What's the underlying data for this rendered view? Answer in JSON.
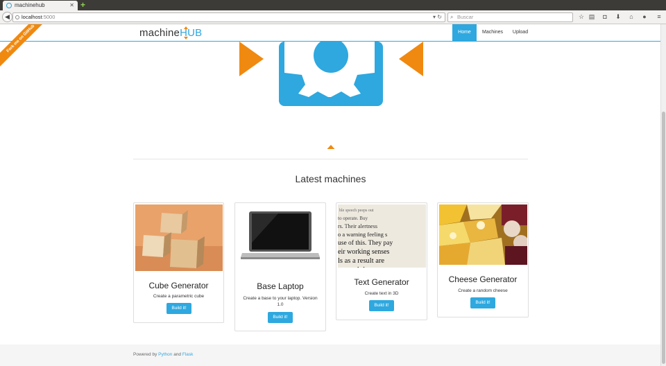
{
  "browser": {
    "tab_title": "machinehub",
    "url_host": "localhost",
    "url_port": ":5000",
    "search_placeholder": "Buscar"
  },
  "site": {
    "brand_prefix": "machine",
    "brand_suffix": "HUB",
    "ribbon": "Fork me on GitHub",
    "nav": [
      {
        "label": "Home",
        "active": true
      },
      {
        "label": "Machines",
        "active": false
      },
      {
        "label": "Upload",
        "active": false
      }
    ],
    "colors": {
      "accent": "#2ea8df",
      "orange": "#f0890f"
    }
  },
  "main": {
    "section_title": "Latest machines",
    "cards": [
      {
        "name": "Cube Generator",
        "desc": "Create a parametric cube",
        "button": "Build it!",
        "image": "wooden-cubes"
      },
      {
        "name": "Base Laptop",
        "desc": "Create a base to your laptop. Version 1.0",
        "button": "Build it!",
        "image": "laptop"
      },
      {
        "name": "Text Generator",
        "desc": "Create text in 3D",
        "button": "Build it!",
        "image": "printed-text"
      },
      {
        "name": "Cheese Generator",
        "desc": "Create a random cheese",
        "button": "Build it!",
        "image": "cheese"
      }
    ]
  },
  "footer": {
    "prefix": "Powered by",
    "link1": "Python",
    "mid": "and",
    "link2": "Flask"
  }
}
